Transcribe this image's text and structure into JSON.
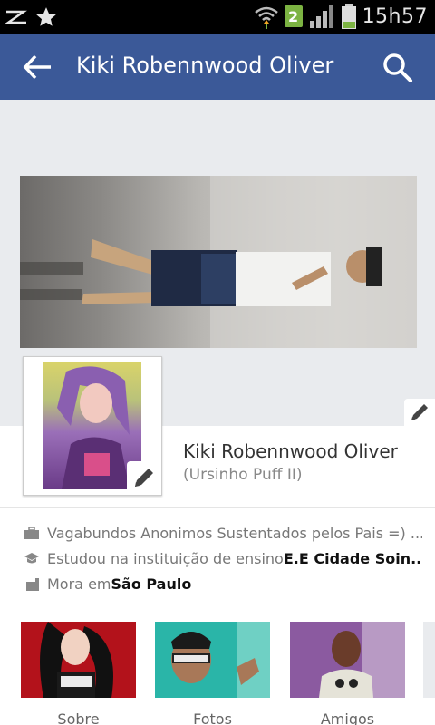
{
  "status_bar": {
    "time": "15h57",
    "notification_count": "2",
    "icons": [
      "signal-z-icon",
      "star-icon",
      "wifi-icon",
      "notification-badge",
      "cell-signal-icon",
      "battery-icon"
    ]
  },
  "app_bar": {
    "title": "Kiki Robennwood Oliver",
    "icons": [
      "back-arrow-icon",
      "search-icon"
    ]
  },
  "profile": {
    "name": "Kiki Robennwood Oliver",
    "nickname": "(Ursinho Puff II)"
  },
  "about": {
    "work": "Vagabundos Anonimos Sustentados pelos Pais =) ...",
    "education_prefix": "Estudou na instituição de ensino ",
    "education_school": "E.E Cidade Soin...",
    "location_prefix": "Mora em ",
    "location_city": "São Paulo"
  },
  "tiles": [
    {
      "label": "Sobre"
    },
    {
      "label": "Fotos"
    },
    {
      "label": "Amigos"
    }
  ],
  "colors": {
    "brand_blue": "#3b5998",
    "status_bar": "#000000",
    "cover_background": "#e9ebee"
  }
}
